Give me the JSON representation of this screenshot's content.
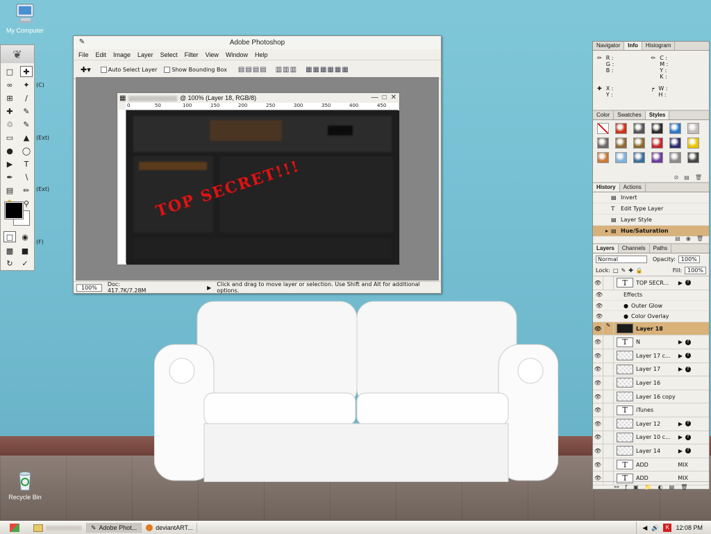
{
  "desktop": {
    "icons": [
      {
        "name": "My Computer"
      },
      {
        "name": "Recycle Bin"
      }
    ]
  },
  "photoshop": {
    "title": "Adobe Photoshop",
    "menu": [
      "File",
      "Edit",
      "Image",
      "Layer",
      "Select",
      "Filter",
      "View",
      "Window",
      "Help"
    ],
    "options": {
      "auto_select_layer": "Auto Select Layer",
      "show_bounding_box": "Show Bounding Box"
    },
    "document": {
      "title": "@ 100% (Layer 18, RGB/8)",
      "ruler_ticks": [
        "0",
        "50",
        "100",
        "150",
        "200",
        "250",
        "300",
        "350",
        "400",
        "450"
      ],
      "stamp_text": "TOP SECRET!!!"
    },
    "status": {
      "zoom": "100%",
      "doc": "Doc: 417.7K/7.28M",
      "hint": "Click and drag to move layer or selection.  Use Shift and Alt for additional options."
    }
  },
  "toolbox": {
    "side_labels": [
      "(C)",
      "(Ext)",
      "(Ext)",
      "(F)"
    ]
  },
  "palettes": {
    "info": {
      "tabs": [
        "Navigator",
        "Info",
        "Histogram"
      ],
      "active": "Info",
      "rgb": [
        "R :",
        "G :",
        "B :"
      ],
      "cmyk": [
        "C :",
        "M :",
        "Y :",
        "K :"
      ],
      "xy": [
        "X :",
        "Y :"
      ],
      "wh": [
        "W :",
        "H :"
      ]
    },
    "styles": {
      "tabs": [
        "Color",
        "Swatches",
        "Styles"
      ],
      "active": "Styles",
      "swatch_colors": [
        "#ffffff",
        "#c8341a",
        "#555555",
        "#2b2b2b",
        "#2a79c4",
        "#bdbdbd",
        "#6b6b6b",
        "#8c6a3a",
        "#8a6b2f",
        "#c1272d",
        "#2e2e6e",
        "#e8c400",
        "#c77838",
        "#7fb2d9",
        "#3b6e9a",
        "#6a3d9a",
        "#8a8a8a",
        "#444444"
      ]
    },
    "history": {
      "tabs": [
        "History",
        "Actions"
      ],
      "active": "History",
      "items": [
        "Invert",
        "Edit Type Layer",
        "Layer Style",
        "Hue/Saturation"
      ],
      "selected": "Hue/Saturation"
    },
    "layers": {
      "tabs": [
        "Layers",
        "Channels",
        "Paths"
      ],
      "active": "Layers",
      "blend_mode": "Normal",
      "opacity_label": "Opacity:",
      "opacity": "100%",
      "lock_label": "Lock:",
      "fill_label": "Fill:",
      "fill": "100%",
      "rows": [
        {
          "name": "TOP SECR...",
          "kind": "text",
          "fx": true
        },
        {
          "name": "Effects",
          "kind": "effects-header"
        },
        {
          "name": "Outer Glow",
          "kind": "effect"
        },
        {
          "name": "Color Overlay",
          "kind": "effect"
        },
        {
          "name": "Layer 18",
          "kind": "dark",
          "selected": true
        },
        {
          "name": "N",
          "kind": "text",
          "fx": true
        },
        {
          "name": "Layer 17 c...",
          "kind": "checker",
          "fx": true
        },
        {
          "name": "Layer 17",
          "kind": "checker",
          "fx": true
        },
        {
          "name": "Layer 16",
          "kind": "checker"
        },
        {
          "name": "Layer 16 copy",
          "kind": "checker"
        },
        {
          "name": "iTunes",
          "kind": "text"
        },
        {
          "name": "Layer 12",
          "kind": "checker",
          "fx": true
        },
        {
          "name": "Layer 10 c...",
          "kind": "checker",
          "fx": true
        },
        {
          "name": "Layer 14",
          "kind": "checker",
          "fx": true
        },
        {
          "name": "ADD",
          "kind": "text",
          "extra": "MIX"
        },
        {
          "name": "ADD",
          "kind": "text",
          "extra": "MIX"
        }
      ]
    }
  },
  "taskbar": {
    "buttons": [
      "Adobe Phot...",
      "deviantART..."
    ],
    "clock": "12:08 PM"
  }
}
